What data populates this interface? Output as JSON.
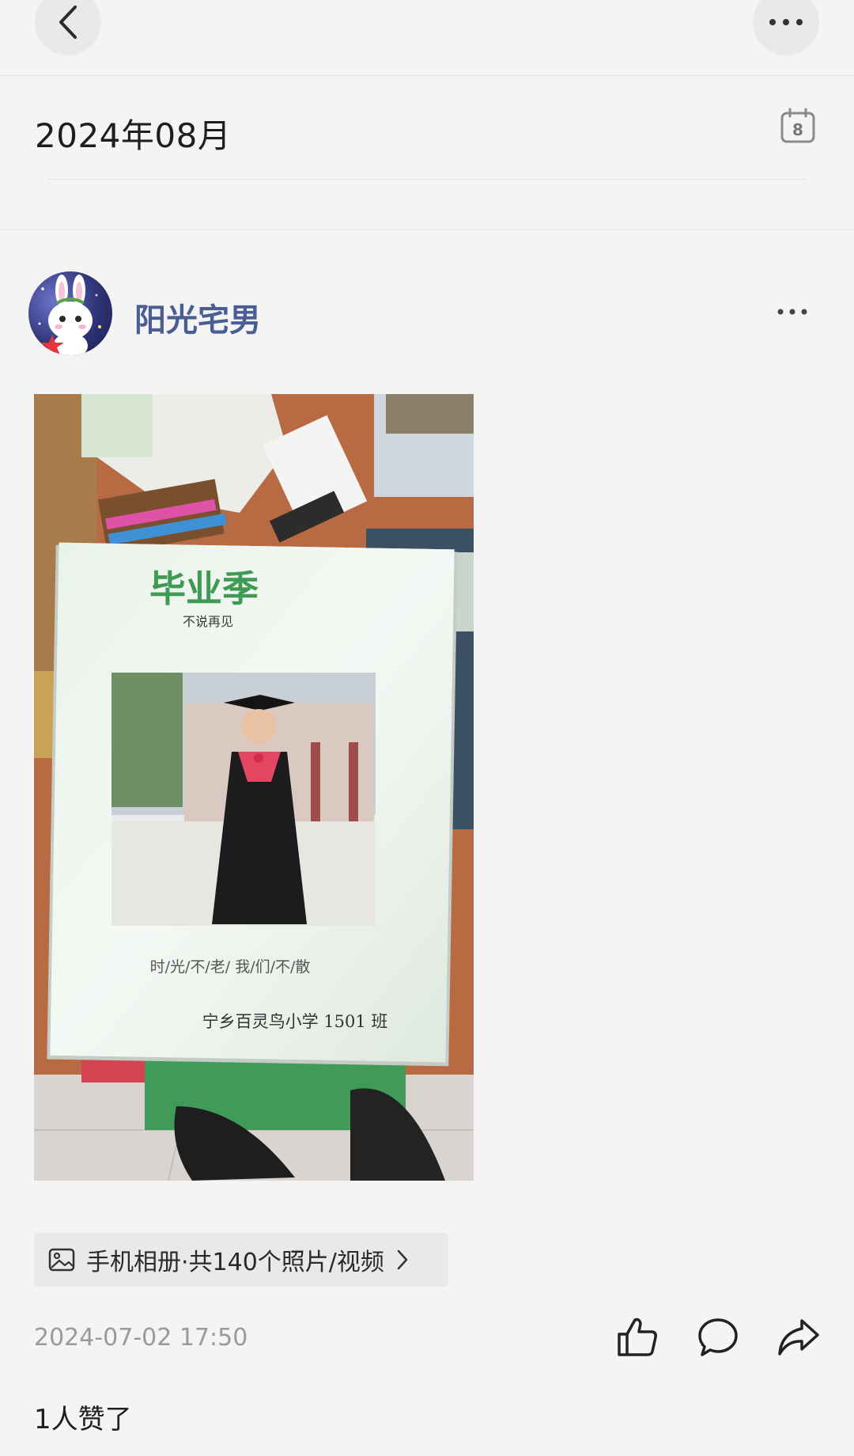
{
  "nav": {
    "back_icon": "chevron-left-icon",
    "more_icon": "ellipsis-icon"
  },
  "header": {
    "month_title": "2024年08月",
    "calendar_day": "8"
  },
  "post": {
    "author_name": "阳光宅男",
    "photo": {
      "book_title": "毕业季",
      "book_subtitle": "不说再见",
      "book_slogan": "时/光/不/老/  我/们/不/散",
      "book_school": "宁乡百灵鸟小学 1501 班"
    },
    "album_label": "手机相册·共140个照片/视频",
    "timestamp": "2024-07-02 17:50",
    "likes_text": "1人赞了"
  },
  "colors": {
    "background": "#f4f4f4",
    "author_name": "#4a5e93",
    "timestamp": "#9a9a9a",
    "chip_bg": "#e9e9e9"
  }
}
